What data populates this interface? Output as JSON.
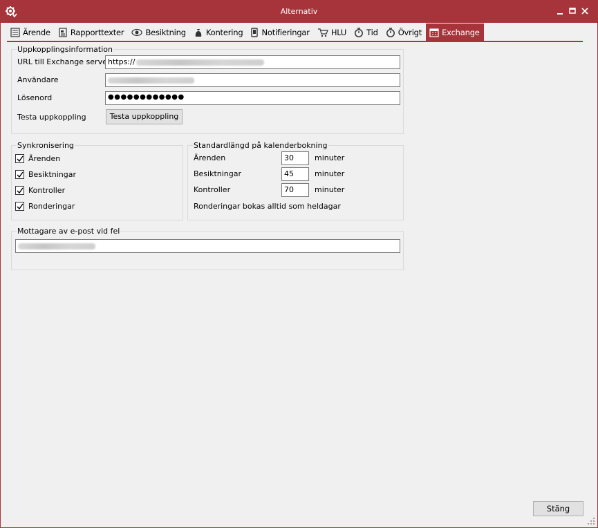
{
  "window": {
    "title": "Alternativ"
  },
  "tabs": [
    {
      "label": "Ärende",
      "icon": "form-icon"
    },
    {
      "label": "Rapporttexter",
      "icon": "report-icon"
    },
    {
      "label": "Besiktning",
      "icon": "eye-icon"
    },
    {
      "label": "Kontering",
      "icon": "money-bag-icon"
    },
    {
      "label": "Notifieringar",
      "icon": "phone-icon"
    },
    {
      "label": "HLU",
      "icon": "cart-icon"
    },
    {
      "label": "Tid",
      "icon": "stopwatch-icon"
    },
    {
      "label": "Övrigt",
      "icon": "stopwatch-icon"
    },
    {
      "label": "Exchange",
      "icon": "calendar-icon",
      "active": true
    }
  ],
  "connection": {
    "legend": "Uppkopplingsinformation",
    "url_label": "URL till Exchange server",
    "url_value": "https://",
    "user_label": "Användare",
    "password_label": "Lösenord",
    "password_value": "●●●●●●●●●●●●",
    "test_label": "Testa uppkoppling",
    "test_button": "Testa uppkoppling"
  },
  "sync": {
    "legend": "Synkronisering",
    "items": [
      {
        "label": "Ärenden",
        "checked": true
      },
      {
        "label": "Besiktningar",
        "checked": true
      },
      {
        "label": "Kontroller",
        "checked": true
      },
      {
        "label": "Ronderingar",
        "checked": true
      }
    ]
  },
  "booking": {
    "legend": "Standardlängd på kalenderbokning",
    "rows": [
      {
        "label": "Ärenden",
        "value": "30",
        "unit": "minuter"
      },
      {
        "label": "Besiktningar",
        "value": "45",
        "unit": "minuter"
      },
      {
        "label": "Kontroller",
        "value": "70",
        "unit": "minuter"
      }
    ],
    "note": "Ronderingar bokas alltid som heldagar"
  },
  "email": {
    "legend": "Mottagare av e-post vid fel"
  },
  "footer": {
    "close_button": "Stäng"
  }
}
